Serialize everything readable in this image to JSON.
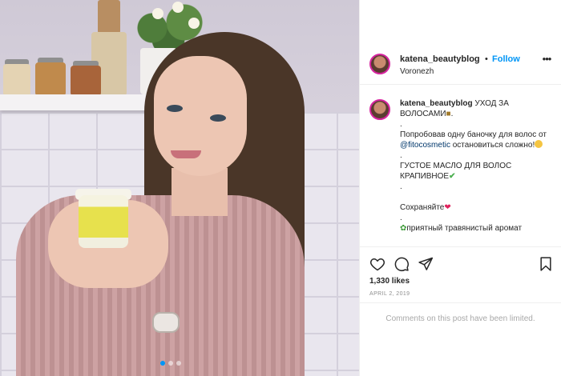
{
  "post": {
    "username": "katena_beautyblog",
    "separator": "•",
    "follow_label": "Follow",
    "location": "Voronezh",
    "more_icon": "more-horizontal-icon",
    "caption": {
      "username": "katena_beautyblog",
      "line1": "УХОД ЗА ВОЛОСАМИ",
      "line1_tail": ".",
      "dot1": ".",
      "line2_pre": "Попробовав одну баночку для волос от ",
      "mention": "@fitocosmetic",
      "line2_post": " остановиться сложно!",
      "dot2": ".",
      "line3": "ГУСТОЕ МАСЛО ДЛЯ ВОЛОС КРАПИВНОЕ",
      "dot3": ".",
      "line4": "Сохраняйте",
      "dot4": ".",
      "line5": "приятный травянистый аромат"
    },
    "likes": "1,330 likes",
    "date": "APRIL 2, 2019",
    "comments_status": "Comments on this post have been limited."
  },
  "carousel": {
    "count": 3,
    "active_index": 0
  },
  "colors": {
    "link": "#0095f6",
    "mention": "#00376b",
    "text": "#262626",
    "muted": "#8e8e8e"
  }
}
